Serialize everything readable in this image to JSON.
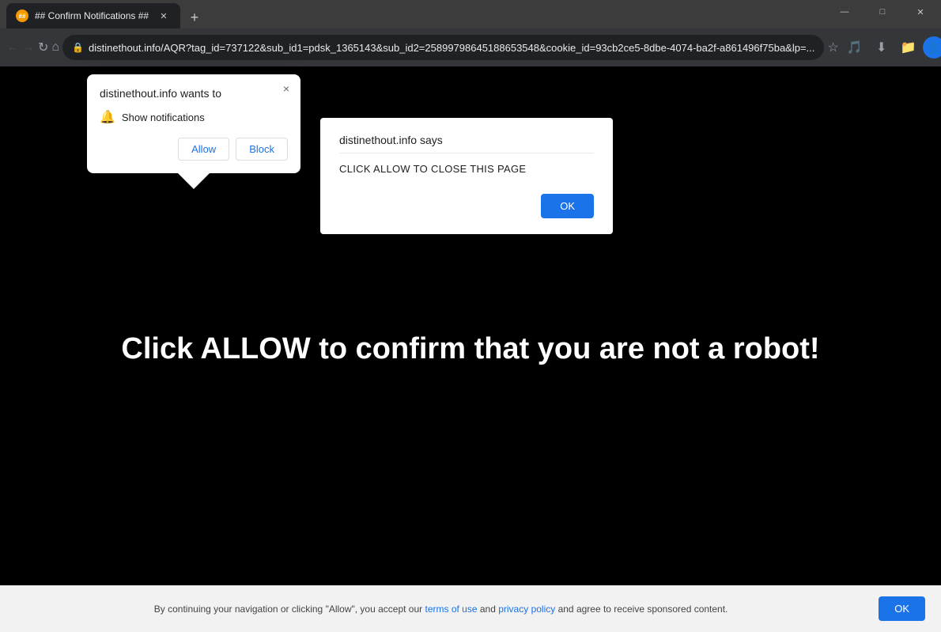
{
  "browser": {
    "tab": {
      "title": "## Confirm Notifications ##",
      "favicon_label": "##"
    },
    "address_bar": {
      "url": "distinethout.info/AQR?tag_id=737122&sub_id1=pdsk_1365143&sub_id2=25899798645188653548&cookie_id=93cb2ce5-8dbe-4074-ba2f-a861496f75ba&lp=..."
    },
    "window_controls": {
      "minimize": "—",
      "maximize": "□",
      "close": "✕"
    }
  },
  "notification_popup": {
    "title": "distinethout.info wants to",
    "option_text": "Show notifications",
    "allow_label": "Allow",
    "block_label": "Block",
    "close_label": "×"
  },
  "alert_dialog": {
    "title": "distinethout.info says",
    "message": "CLICK ALLOW TO CLOSE THIS PAGE",
    "ok_label": "OK"
  },
  "page": {
    "main_text": "Click ALLOW to confirm that you are not a robot!"
  },
  "bottom_banner": {
    "text_before": "By continuing your navigation or clicking \"Allow\", you accept our ",
    "terms_link": "terms of use",
    "text_middle": " and ",
    "privacy_link": "privacy policy",
    "text_after": " and agree to receive sponsored content.",
    "ok_label": "OK"
  }
}
